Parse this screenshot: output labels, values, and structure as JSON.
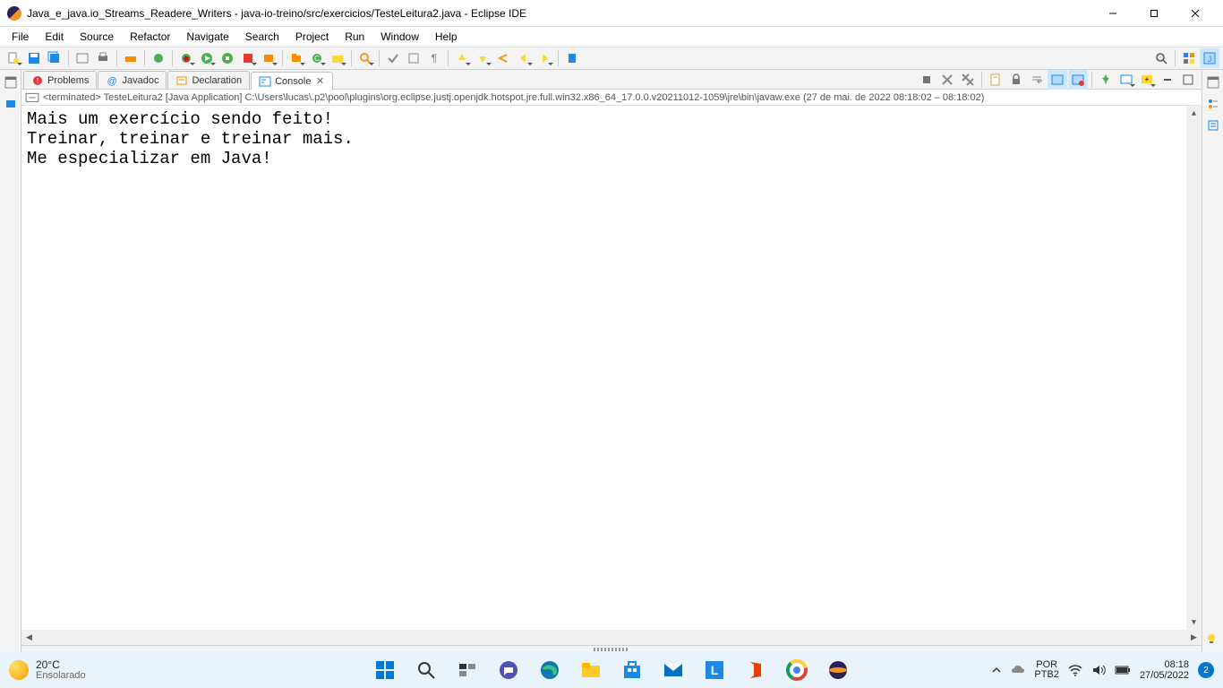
{
  "window": {
    "title": "Java_e_java.io_Streams_Readere_Writers - java-io-treino/src/exercicios/TesteLeitura2.java - Eclipse IDE"
  },
  "menu": {
    "items": [
      "File",
      "Edit",
      "Source",
      "Refactor",
      "Navigate",
      "Search",
      "Project",
      "Run",
      "Window",
      "Help"
    ]
  },
  "tabs": {
    "items": [
      {
        "label": "Problems",
        "icon": "problems"
      },
      {
        "label": "Javadoc",
        "icon": "javadoc"
      },
      {
        "label": "Declaration",
        "icon": "declaration"
      },
      {
        "label": "Console",
        "icon": "console",
        "active": true,
        "closable": true
      }
    ]
  },
  "console": {
    "status": "<terminated> TesteLeitura2 [Java Application] C:\\Users\\lucas\\.p2\\pool\\plugins\\org.eclipse.justj.openjdk.hotspot.jre.full.win32.x86_64_17.0.0.v20211012-1059\\jre\\bin\\javaw.exe  (27 de mai. de 2022 08:18:02 – 08:18:02)",
    "lines": [
      "Mais um exercício sendo feito!",
      "Treinar, treinar e treinar mais.",
      "Me especializar em Java!"
    ]
  },
  "taskbar": {
    "weather": {
      "temp": "20°C",
      "desc": "Ensolarado"
    },
    "lang": {
      "top": "POR",
      "bottom": "PTB2"
    },
    "clock": {
      "time": "08:18",
      "date": "27/05/2022"
    },
    "notif_count": "2"
  }
}
